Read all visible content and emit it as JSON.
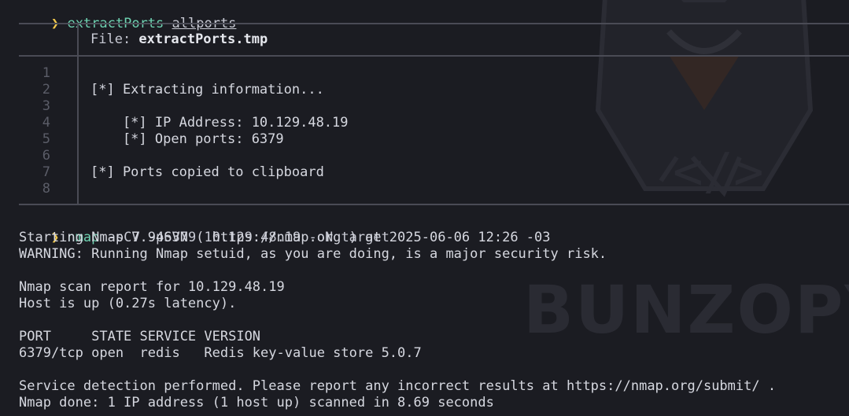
{
  "watermark": {
    "text": "BUNZOPY"
  },
  "first_command": {
    "prompt_symbol": "❯",
    "command": "extractPorts",
    "argument": "allports"
  },
  "bat": {
    "file_label": "File: ",
    "file_name": "extractPorts.tmp",
    "line_numbers": [
      "1",
      "2",
      "3",
      "4",
      "5",
      "6",
      "7",
      "8"
    ],
    "lines": [
      "",
      "[*] Extracting information...",
      "",
      "    [*] IP Address: 10.129.48.19",
      "    [*] Open ports: 6379",
      "",
      "[*] Ports copied to clipboard",
      ""
    ]
  },
  "second_command": {
    "prompt_symbol": "❯",
    "command": "nmap",
    "arguments": " -sCV -p6379 10.129.48.19 -oN target"
  },
  "output": [
    "Starting Nmap 7.94SVN ( https://nmap.org ) at 2025-06-06 12:26 -03",
    "WARNING: Running Nmap setuid, as you are doing, is a major security risk.",
    "",
    "Nmap scan report for 10.129.48.19",
    "Host is up (0.27s latency).",
    "",
    "PORT     STATE SERVICE VERSION",
    "6379/tcp open  redis   Redis key-value store 5.0.7",
    "",
    "Service detection performed. Please report any incorrect results at https://nmap.org/submit/ .",
    "Nmap done: 1 IP address (1 host up) scanned in 8.69 seconds"
  ],
  "colors": {
    "background": "#1b1c22",
    "prompt": "#f2c94c",
    "command": "#6fd3b2",
    "text": "#d6d8e0",
    "border": "#4a4b55",
    "line_number": "#5b5d68"
  }
}
